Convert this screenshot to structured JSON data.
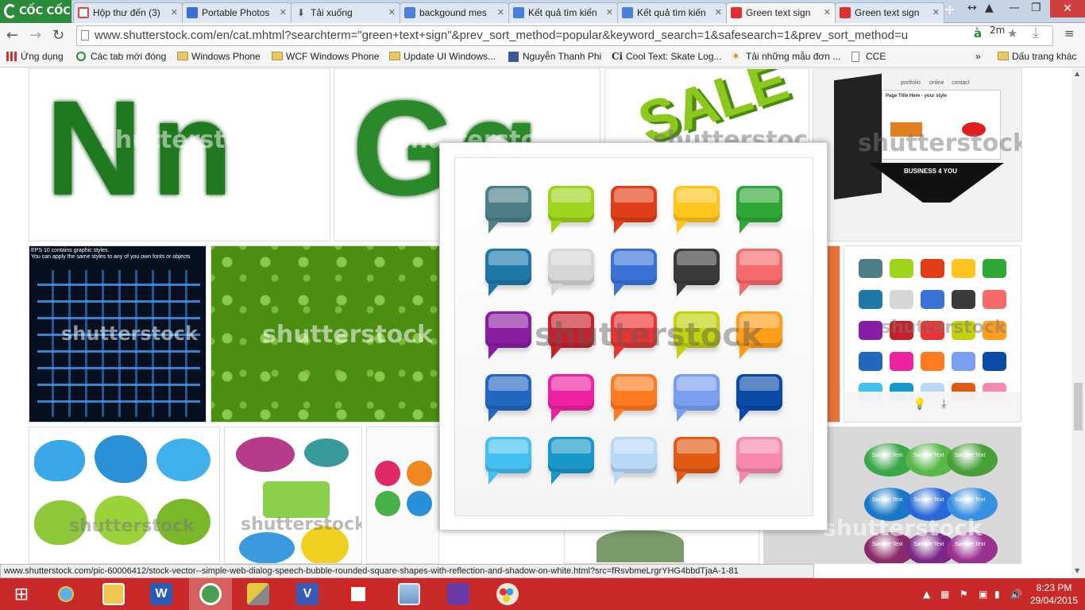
{
  "browser": {
    "logo_text": "CỐC CỐC",
    "tabs": [
      {
        "label": "Hộp thư đến (3)",
        "favicon_color": "#d44"
      },
      {
        "label": "Portable Photos",
        "favicon_color": "#3a6fd8"
      },
      {
        "label": "Tải xuống",
        "favicon_color": "#666"
      },
      {
        "label": "backgound mes",
        "favicon_color": "#4a7fe0"
      },
      {
        "label": "Kết quả tìm kiến",
        "favicon_color": "#4a7fe0"
      },
      {
        "label": "Kết quả tìm kiến",
        "favicon_color": "#4a7fe0"
      },
      {
        "label": "Green text sign",
        "favicon_color": "#e03030"
      },
      {
        "label": "Green text sign",
        "favicon_color": "#e03030"
      }
    ],
    "active_tab_index": 6,
    "url": "www.shutterstock.com/en/cat.mhtml?searchterm=\"green+text+sign\"&prev_sort_method=popular&keyword_search=1&safesearch=1&prev_sort_method=u",
    "bookmarks": [
      {
        "label": "Ứng dụng",
        "icon": "apps-icon"
      },
      {
        "label": "Các tab mới đóng",
        "icon": "recent-tabs-icon"
      },
      {
        "label": "Windows Phone",
        "icon": "folder-icon"
      },
      {
        "label": "WCF Windows Phone",
        "icon": "folder-icon"
      },
      {
        "label": "Update UI Windows...",
        "icon": "folder-icon"
      },
      {
        "label": "Nguyễn Thanh Phi",
        "icon": "facebook-icon"
      },
      {
        "label": "Cool Text: Skate Log...",
        "icon": "cooltext-icon"
      },
      {
        "label": "Tải những mẫu đơn ...",
        "icon": "star-icon"
      },
      {
        "label": "CCE",
        "icon": "page-icon"
      },
      {
        "label": "Dấu trang khác",
        "icon": "folder-icon"
      }
    ],
    "bookmark_more": "»",
    "download_badge": "2m"
  },
  "content": {
    "watermark": "shutterstock",
    "thumb_texts": {
      "eps_line1": "EPS 10 contains graphic styles.",
      "eps_line2": "You can apply the same styles to any of you own fonts or objects",
      "portfolio": "portfolio",
      "online": "online",
      "contact": "contact",
      "page_title": "Page Title Here - your style",
      "business": "BUSINESS 4 YOU",
      "sample": "Sample Text"
    },
    "popup_bubble_colors": [
      "#4d7f88",
      "#9fd41c",
      "#e03e18",
      "#ffc41e",
      "#2fa836",
      "#1f78a8",
      "#d6d6d6",
      "#3a72d8",
      "#3b3b3b",
      "#f66a6a",
      "#8a1ea0",
      "#c8202a",
      "#ee3232",
      "#c2d20c",
      "#ff9c18",
      "#2268c0",
      "#ee22a0",
      "#ff7a1e",
      "#7a9ff0",
      "#0a4aa8",
      "#44c0f0",
      "#1898c8",
      "#b8d8f8",
      "#e05a14",
      "#f888b0"
    ]
  },
  "status_bar": "www.shutterstock.com/pic-60006412/stock-vector--simple-web-dialog-speech-bubble-rounded-square-shapes-with-reflection-and-shadow-on-white.html?src=fRsvbmeLrgrYHG4bbdTjaA-1-81",
  "taskbar": {
    "items": [
      "start-icon",
      "ie-icon",
      "file-explorer-icon",
      "word-icon",
      "coccoc-icon",
      "tools-icon",
      "visio-icon",
      "visual-studio-red-icon",
      "photo-viewer-icon",
      "visual-studio-icon",
      "paint-icon"
    ],
    "active_index": 4,
    "time": "8:23 PM",
    "date": "29/04/2015"
  }
}
